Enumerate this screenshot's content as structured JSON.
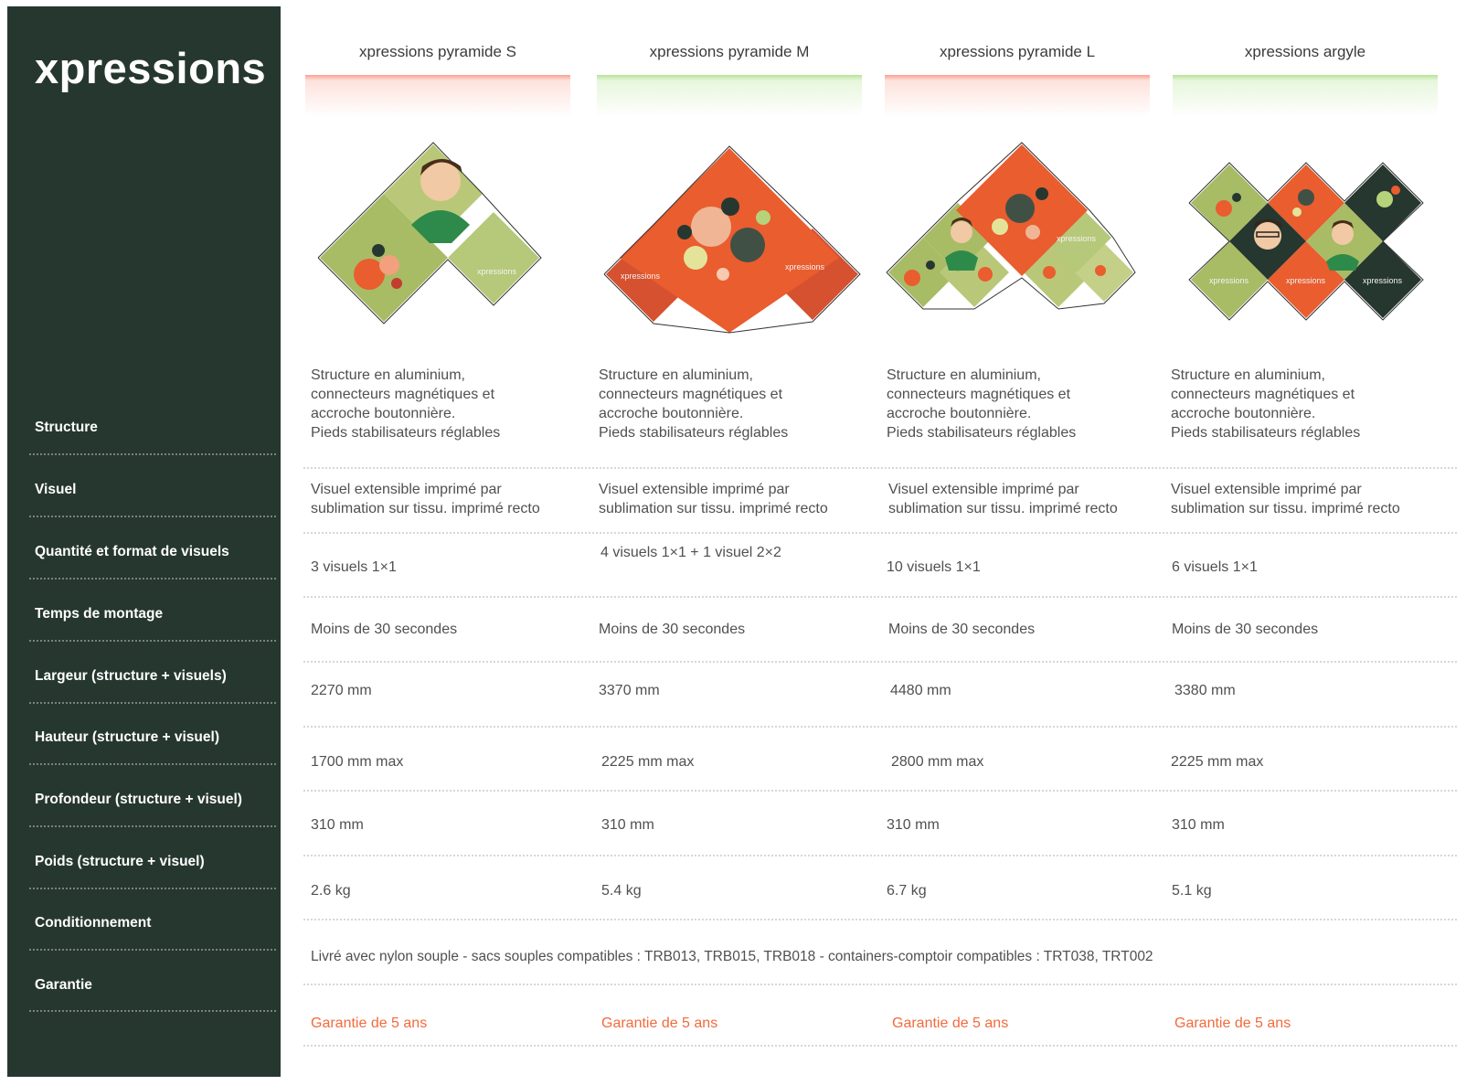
{
  "brand": {
    "name": "xpressions"
  },
  "row_labels": [
    "Structure",
    "Visuel",
    "Quantité et format de visuels",
    "Temps de montage",
    "Largeur (structure + visuels)",
    "Hauteur  (structure + visuel)",
    "Profondeur  (structure + visuel)",
    "Poids  (structure + visuel)",
    "Conditionnement",
    "Garantie"
  ],
  "products": [
    {
      "name": "xpressions pyramide S",
      "accent": "red",
      "structure": [
        "Structure en aluminium,",
        "connecteurs magnétiques et",
        "accroche boutonnière.",
        "Pieds stabilisateurs réglables"
      ],
      "visuel": [
        "Visuel extensible imprimé par",
        "sublimation sur tissu. imprimé recto"
      ],
      "quantite": "3 visuels 1×1",
      "montage": "Moins de 30 secondes",
      "largeur": "2270 mm",
      "hauteur": "1700 mm max",
      "profondeur": "310 mm",
      "poids": "2.6 kg",
      "garantie": "Garantie de 5 ans",
      "image_label": "xpressions"
    },
    {
      "name": "xpressions pyramide M",
      "accent": "green",
      "structure": [
        "Structure en aluminium,",
        "connecteurs magnétiques et",
        "accroche boutonnière.",
        "Pieds stabilisateurs réglables"
      ],
      "visuel": [
        "Visuel extensible imprimé par",
        "sublimation sur tissu. imprimé recto"
      ],
      "quantite": "4 visuels 1×1 + 1 visuel 2×2",
      "montage": "Moins de 30 secondes",
      "largeur": "3370 mm",
      "hauteur": "2225 mm max",
      "profondeur": "310 mm",
      "poids": "5.4 kg",
      "garantie": "Garantie de 5 ans",
      "image_label": "xpressions"
    },
    {
      "name": "xpressions pyramide L",
      "accent": "red",
      "structure": [
        "Structure en aluminium,",
        "connecteurs magnétiques et",
        "accroche boutonnière.",
        "Pieds stabilisateurs réglables"
      ],
      "visuel": [
        "Visuel extensible imprimé par",
        "sublimation sur tissu. imprimé recto"
      ],
      "quantite": "10 visuels 1×1",
      "montage": "Moins de 30 secondes",
      "largeur": "4480 mm",
      "hauteur": "2800 mm max",
      "profondeur": "310 mm",
      "poids": "6.7 kg",
      "garantie": "Garantie de 5 ans",
      "image_label": "xpressions"
    },
    {
      "name": "xpressions argyle",
      "accent": "green",
      "structure": [
        "Structure en aluminium,",
        "connecteurs magnétiques et",
        "accroche boutonnière.",
        "Pieds stabilisateurs réglables"
      ],
      "visuel": [
        "Visuel extensible imprimé par",
        "sublimation sur tissu. imprimé recto"
      ],
      "quantite": "6 visuels 1×1",
      "montage": "Moins de 30 secondes",
      "largeur": "3380 mm",
      "hauteur": "2225 mm max",
      "profondeur": "310 mm",
      "poids": "5.1 kg",
      "garantie": "Garantie de 5 ans",
      "image_label": "xpressions"
    }
  ],
  "conditionnement": "Livré avec nylon souple - sacs souples compatibles : TRB013, TRB015, TRB018 - containers-comptoir compatibles : TRT038, TRT002",
  "colors": {
    "sidebar": "#263730",
    "accent_orange": "#e95d2f",
    "accent_green": "#a8bc66",
    "warranty": "#f26a3c",
    "header_red": "#f8a291",
    "header_green": "#b7e394"
  }
}
